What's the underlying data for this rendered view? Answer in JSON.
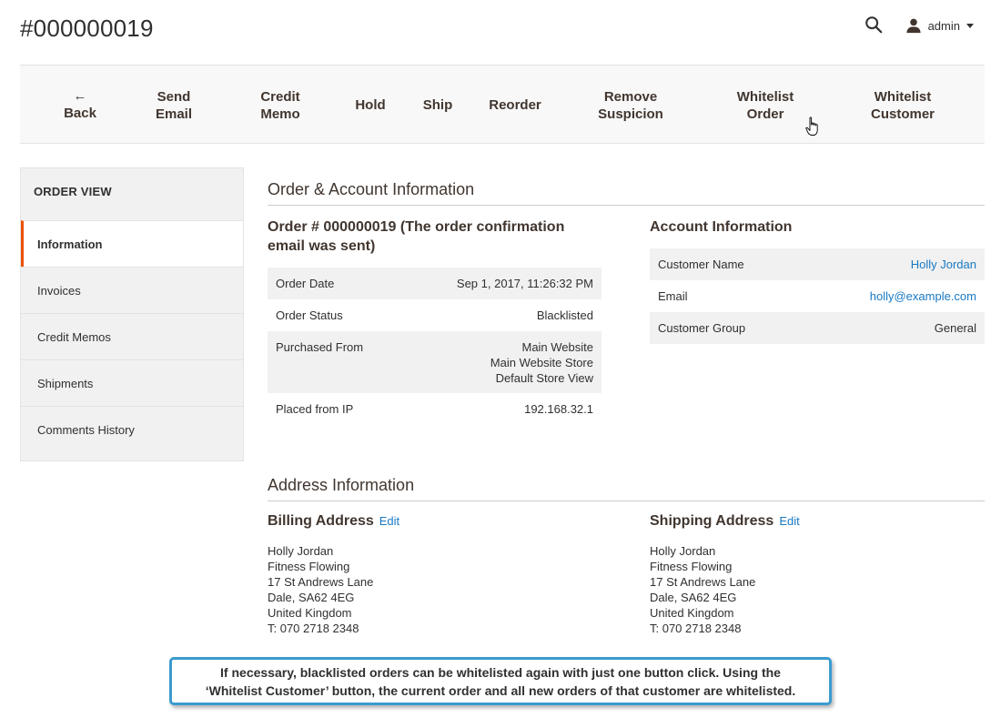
{
  "page": {
    "title": "#000000019"
  },
  "header": {
    "user": "admin"
  },
  "toolbar": {
    "back": "Back",
    "send_email": [
      "Send",
      "Email"
    ],
    "credit_memo": [
      "Credit",
      "Memo"
    ],
    "hold": "Hold",
    "ship": "Ship",
    "reorder": "Reorder",
    "remove_suspicion": [
      "Remove",
      "Suspicion"
    ],
    "whitelist_order": [
      "Whitelist",
      "Order"
    ],
    "whitelist_customer": [
      "Whitelist",
      "Customer"
    ]
  },
  "sidebar": {
    "title": "ORDER VIEW",
    "items": [
      {
        "label": "Information"
      },
      {
        "label": "Invoices"
      },
      {
        "label": "Credit Memos"
      },
      {
        "label": "Shipments"
      },
      {
        "label": "Comments History"
      }
    ]
  },
  "order_account": {
    "section_title": "Order & Account Information",
    "order_title": [
      "Order # 000000019 (The order confirmation",
      "email was sent)"
    ],
    "order_rows": [
      {
        "label": "Order Date",
        "value": "Sep 1, 2017, 11:26:32 PM"
      },
      {
        "label": "Order Status",
        "value": "Blacklisted"
      },
      {
        "label": "Purchased From",
        "value": [
          "Main Website",
          "Main Website Store",
          "Default Store View"
        ]
      },
      {
        "label": "Placed from IP",
        "value": "192.168.32.1"
      }
    ],
    "account_title": "Account Information",
    "account_rows": [
      {
        "label": "Customer Name",
        "value": "Holly Jordan"
      },
      {
        "label": "Email",
        "value": "holly@example.com"
      },
      {
        "label": "Customer Group",
        "value": "General"
      }
    ]
  },
  "address": {
    "section_title": "Address Information",
    "edit_label": "Edit",
    "billing": {
      "title": "Billing Address",
      "lines": [
        "Holly Jordan",
        "Fitness Flowing",
        "17 St Andrews Lane",
        "Dale, SA62 4EG",
        "United Kingdom",
        "T: 070 2718 2348"
      ]
    },
    "shipping": {
      "title": "Shipping Address",
      "lines": [
        "Holly Jordan",
        "Fitness Flowing",
        "17 St Andrews Lane",
        "Dale, SA62 4EG",
        "United Kingdom",
        "T: 070 2718 2348"
      ]
    }
  },
  "callout": {
    "lines": [
      "If necessary, blacklisted orders can be whitelisted again with just one button click. Using the",
      "‘Whitelist Customer’ button, the current order and all new orders of that customer are whitelisted."
    ]
  },
  "colors": {
    "accent": "#eb5202",
    "link": "#1979c3",
    "callout_border": "#3a9bd0"
  },
  "icons": [
    "search-icon",
    "user-icon",
    "back-arrow-icon",
    "hand-cursor-icon"
  ]
}
